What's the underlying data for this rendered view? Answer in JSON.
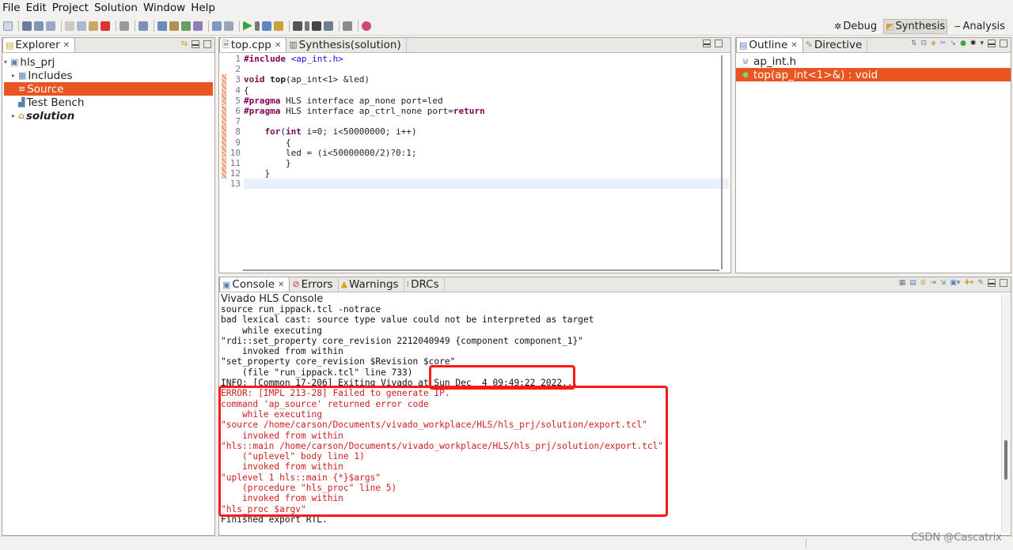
{
  "menu": [
    "File",
    "Edit",
    "Project",
    "Solution",
    "Window",
    "Help"
  ],
  "perspectives": [
    {
      "label": "Debug",
      "icon": "bug-icon",
      "active": false
    },
    {
      "label": "Synthesis",
      "icon": "synthesis-icon",
      "active": true
    },
    {
      "label": "Analysis",
      "icon": "analysis-icon",
      "active": false
    }
  ],
  "explorer": {
    "tab": "Explorer",
    "items": [
      {
        "label": "hls_prj",
        "icon": "project-icon"
      },
      {
        "label": "Includes",
        "icon": "includes-icon"
      },
      {
        "label": "Source",
        "icon": "source-folder-icon",
        "selected": true
      },
      {
        "label": "Test Bench",
        "icon": "testbench-icon"
      },
      {
        "label": "solution",
        "icon": "solution-icon"
      }
    ]
  },
  "editor": {
    "tabs": [
      {
        "label": "top.cpp",
        "active": true
      },
      {
        "label": "Synthesis(solution)",
        "active": false
      }
    ],
    "line_numbers": [
      "1",
      "2",
      "3",
      "4",
      "5",
      "6",
      "7",
      "8",
      "9",
      "10",
      "11",
      "12",
      "13"
    ],
    "lines": [
      "#include <ap_int.h>",
      "",
      "void top(ap_int<1> &led)",
      "{",
      "#pragma HLS interface ap_none port=led",
      "#pragma HLS interface ap_ctrl_none port=return",
      "",
      "    for(int i=0; i<50000000; i++)",
      "        {",
      "        led = (i<50000000/2)?0:1;",
      "        }",
      "    }",
      ""
    ]
  },
  "outline": {
    "tabs": [
      "Outline",
      "Directive"
    ],
    "items": [
      {
        "label": "ap_int.h",
        "selected": false
      },
      {
        "label": "top(ap_int<1>&) : void",
        "selected": true
      }
    ]
  },
  "console": {
    "tabs": [
      "Console",
      "Errors",
      "Warnings",
      "DRCs"
    ],
    "title": "Vivado HLS Console",
    "lines": [
      {
        "text": "source run_ippack.tcl -notrace",
        "error": false
      },
      {
        "text": "bad lexical cast: source type value could not be interpreted as target",
        "error": false
      },
      {
        "text": "    while executing",
        "error": false
      },
      {
        "text": "\"rdi::set_property core_revision 2212040949 {component component_1}\"",
        "error": false
      },
      {
        "text": "    invoked from within",
        "error": false
      },
      {
        "text": "\"set_property core_revision $Revision $core\"",
        "error": false
      },
      {
        "text": "    (file \"run_ippack.tcl\" line 733)",
        "error": false
      },
      {
        "text": "INFO: [Common 17-206] Exiting Vivado at Sun Dec  4 09:49:22 2022...",
        "error": false
      },
      {
        "text": "ERROR: [IMPL 213-28] Failed to generate IP.",
        "error": true
      },
      {
        "text": "command 'ap_source' returned error code",
        "error": true
      },
      {
        "text": "    while executing",
        "error": true
      },
      {
        "text": "\"source /home/carson/Documents/vivado_workplace/HLS/hls_prj/solution/export.tcl\"",
        "error": true
      },
      {
        "text": "    invoked from within",
        "error": true
      },
      {
        "text": "\"hls::main /home/carson/Documents/vivado_workplace/HLS/hls_prj/solution/export.tcl\"",
        "error": true
      },
      {
        "text": "    (\"uplevel\" body line 1)",
        "error": true
      },
      {
        "text": "    invoked from within",
        "error": true
      },
      {
        "text": "\"uplevel 1 hls::main {*}$args\"",
        "error": true
      },
      {
        "text": "    (procedure \"hls_proc\" line 5)",
        "error": true
      },
      {
        "text": "    invoked from within",
        "error": true
      },
      {
        "text": "\"hls_proc $argv\"",
        "error": true
      },
      {
        "text": "Finished export RTL.",
        "error": false
      }
    ]
  },
  "watermark": "CSDN @Cascatrix"
}
